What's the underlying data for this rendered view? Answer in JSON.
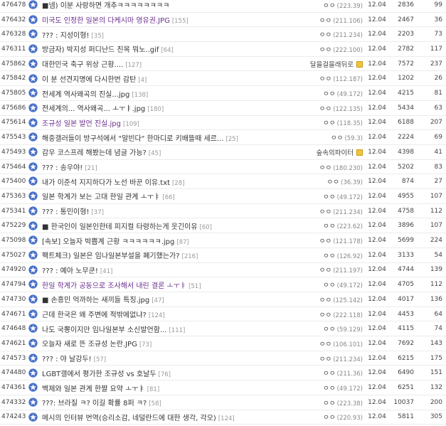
{
  "colors": {
    "star": "#4a72c7",
    "visited_title": "#6a2e8f",
    "fix_icon": "#f3c43a"
  },
  "icon": "star-icon",
  "posts": [
    {
      "num": "476478",
      "title": "■넴) 이분 사랑하면 개추ㅋㅋㅋㅋㅋㅋㅋㅋ",
      "comments": "",
      "writer": "ㅇㅇ",
      "ip": "(223.39)",
      "date": "12.04",
      "views": "2836",
      "recs": "99",
      "visited": false,
      "fixed": false
    },
    {
      "num": "476432",
      "title": "미국도 인정한 일본의 다케시마 영유권.JPG",
      "comments": "[155]",
      "writer": "ㅇㅇ",
      "ip": "(211.106)",
      "date": "12.04",
      "views": "2467",
      "recs": "36",
      "visited": true,
      "fixed": false
    },
    {
      "num": "476328",
      "title": "??? : 지성이형!",
      "comments": "[35]",
      "writer": "ㅇㅇ",
      "ip": "(211.234)",
      "date": "12.04",
      "views": "2203",
      "recs": "73",
      "visited": false,
      "fixed": false
    },
    {
      "num": "476311",
      "title": "방금자) 박지성 퍼디난드 친목 뭐노..gif",
      "comments": "[64]",
      "writer": "ㅇㅇ",
      "ip": "(222.100)",
      "date": "12.04",
      "views": "2782",
      "recs": "117",
      "visited": false,
      "fixed": false
    },
    {
      "num": "475862",
      "title": "대한민국 축구 위상 근황....",
      "comments": "[127]",
      "writer": "달을걸을래뒤로",
      "ip": "",
      "date": "12.04",
      "views": "7572",
      "recs": "237",
      "visited": false,
      "fixed": true
    },
    {
      "num": "475842",
      "title": "이 분 선견지명에 다시한번 감탄",
      "comments": "[4]",
      "writer": "ㅇㅇ",
      "ip": "(112.187)",
      "date": "12.04",
      "views": "1202",
      "recs": "26",
      "visited": false,
      "fixed": false
    },
    {
      "num": "475805",
      "title": "전세계 역사왜곡의 진실...jpg",
      "comments": "[138]",
      "writer": "ㅇㅇ",
      "ip": "(49.172)",
      "date": "12.04",
      "views": "4215",
      "recs": "81",
      "visited": false,
      "fixed": false
    },
    {
      "num": "475686",
      "title": "전세계의... 역사왜곡... ㅗㅜㅑ.jpg",
      "comments": "[180]",
      "writer": "ㅇㅇ",
      "ip": "(122.135)",
      "date": "12.04",
      "views": "5434",
      "recs": "63",
      "visited": false,
      "fixed": false
    },
    {
      "num": "475614",
      "title": "조규성 일본 발언 진실.jpg",
      "comments": "[109]",
      "writer": "ㅇㅇ",
      "ip": "(118.35)",
      "date": "12.04",
      "views": "6188",
      "recs": "207",
      "visited": true,
      "fixed": false
    },
    {
      "num": "475543",
      "title": "해중갤러들이 방구석에서 \"알빈다\" 한마디로 키배뜰때 세르...",
      "comments": "[25]",
      "writer": "ㅇㅇ",
      "ip": "(59.3)",
      "date": "12.04",
      "views": "2224",
      "recs": "69",
      "visited": false,
      "fixed": false
    },
    {
      "num": "475493",
      "title": "감우 코스프레 해봤는데 념글 가능?",
      "comments": "[45]",
      "writer": "숲속의파이터",
      "ip": "",
      "date": "12.04",
      "views": "4398",
      "recs": "41",
      "visited": false,
      "fixed": true
    },
    {
      "num": "475464",
      "title": "??? : 송우야!",
      "comments": "[21]",
      "writer": "ㅇㅇ",
      "ip": "(180.230)",
      "date": "12.04",
      "views": "5202",
      "recs": "83",
      "visited": false,
      "fixed": false
    },
    {
      "num": "475400",
      "title": "내가 이준석 지지하다가 노선 바꾼 이유.txt",
      "comments": "[28]",
      "writer": "ㅇㅇ",
      "ip": "(36.39)",
      "date": "12.04",
      "views": "874",
      "recs": "27",
      "visited": false,
      "fixed": false
    },
    {
      "num": "475363",
      "title": "일본 학계가 보는 고대 한일 관계 ㅗㅜㅑ",
      "comments": "[66]",
      "writer": "ㅇㅇ",
      "ip": "(49.172)",
      "date": "12.04",
      "views": "4955",
      "recs": "107",
      "visited": false,
      "fixed": false
    },
    {
      "num": "475341",
      "title": "??? : 통민이형!",
      "comments": "[37]",
      "writer": "ㅇㅇ",
      "ip": "(211.234)",
      "date": "12.04",
      "views": "4758",
      "recs": "112",
      "visited": false,
      "fixed": false
    },
    {
      "num": "475229",
      "title": "■ 한국인이 일본인한테 피지컬 타령하는게 웃긴이유",
      "comments": "[60]",
      "writer": "ㅇㅇ",
      "ip": "(223.62)",
      "date": "12.04",
      "views": "3896",
      "recs": "107",
      "visited": false,
      "fixed": false
    },
    {
      "num": "475098",
      "title": "[속보] 오늘자 박쁨계 근황 ㅋㅋㅋㅋㅋㅋ.jpg",
      "comments": "[87]",
      "writer": "ㅇㅇ",
      "ip": "(121.178)",
      "date": "12.04",
      "views": "5699",
      "recs": "224",
      "visited": false,
      "fixed": false
    },
    {
      "num": "475027",
      "title": "팩트체크) 일본은 임나일본부설을 폐기했는가?",
      "comments": "[216]",
      "writer": "ㅇㅇ",
      "ip": "(126.92)",
      "date": "12.04",
      "views": "3133",
      "recs": "54",
      "visited": false,
      "fixed": false
    },
    {
      "num": "474920",
      "title": "??? : 예아 노무쿤!",
      "comments": "[41]",
      "writer": "ㅇㅇ",
      "ip": "(211.197)",
      "date": "12.04",
      "views": "4744",
      "recs": "139",
      "visited": false,
      "fixed": false
    },
    {
      "num": "474794",
      "title": "한일 학계가 공동으로 조사해서 내린 결론 ㅗㅜㅑ",
      "comments": "[51]",
      "writer": "ㅇㅇ",
      "ip": "(49.172)",
      "date": "12.04",
      "views": "4705",
      "recs": "112",
      "visited": true,
      "fixed": false
    },
    {
      "num": "474730",
      "title": "■ 손흥민 억까하는 새끼들 특징.jpg",
      "comments": "[47]",
      "writer": "ㅇㅇ",
      "ip": "(125.142)",
      "date": "12.04",
      "views": "4017",
      "recs": "136",
      "visited": false,
      "fixed": false
    },
    {
      "num": "474671",
      "title": "근데 한국은 왜 주변에 적밖에없냐?",
      "comments": "[124]",
      "writer": "ㅇㅇ",
      "ip": "(222.118)",
      "date": "12.04",
      "views": "4453",
      "recs": "64",
      "visited": false,
      "fixed": false
    },
    {
      "num": "474648",
      "title": "나도 국뽕이지만 임나일본부 소신발언함...",
      "comments": "[111]",
      "writer": "ㅇㅇ",
      "ip": "(59.129)",
      "date": "12.04",
      "views": "4115",
      "recs": "74",
      "visited": false,
      "fixed": false
    },
    {
      "num": "474621",
      "title": "오늘자 새로 뜬 조규성 논란.JPG",
      "comments": "[73]",
      "writer": "ㅇㅇ",
      "ip": "(106.101)",
      "date": "12.04",
      "views": "7692",
      "recs": "143",
      "visited": false,
      "fixed": false
    },
    {
      "num": "474573",
      "title": "??? : 야 날강두!",
      "comments": "[57]",
      "writer": "ㅇㅇ",
      "ip": "(211.234)",
      "date": "12.04",
      "views": "6215",
      "recs": "175",
      "visited": false,
      "fixed": false
    },
    {
      "num": "474480",
      "title": "LGBT갤에서 평가한 조규성 vs 호날두",
      "comments": "[76]",
      "writer": "ㅇㅇ",
      "ip": "(211.36)",
      "date": "12.04",
      "views": "6490",
      "recs": "151",
      "visited": false,
      "fixed": false
    },
    {
      "num": "474361",
      "title": "백제와 일본 관계 한짤 요약 ㅗㅜㅑ",
      "comments": "[81]",
      "writer": "ㅇㅇ",
      "ip": "(49.172)",
      "date": "12.04",
      "views": "6251",
      "recs": "132",
      "visited": false,
      "fixed": false
    },
    {
      "num": "474332",
      "title": "???: 브라질 ㅋ? 이길 확률 8퍼 ㅋ?",
      "comments": "[58]",
      "writer": "ㅇㅇ",
      "ip": "(223.38)",
      "date": "12.04",
      "views": "10037",
      "recs": "200",
      "visited": false,
      "fixed": false
    },
    {
      "num": "474243",
      "title": "메시의 인터뷰 번역(승리소감, 네덜란드에 대한 생각, 각오)",
      "comments": "[124]",
      "writer": "ㅇㅇ",
      "ip": "(220.93)",
      "date": "12.04",
      "views": "5811",
      "recs": "305",
      "visited": false,
      "fixed": false
    }
  ]
}
